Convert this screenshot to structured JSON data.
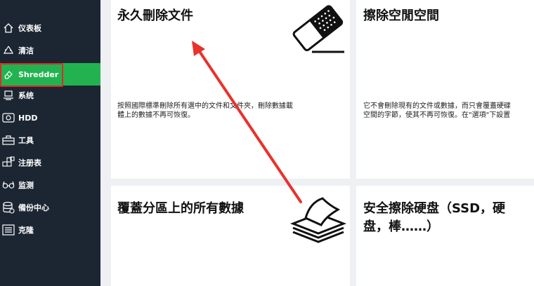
{
  "sidebar": {
    "items": [
      {
        "label": "仪表板",
        "icon": "home-icon"
      },
      {
        "label": "清洁",
        "icon": "recycle-icon"
      },
      {
        "label": "Shredder",
        "icon": "eraser-icon",
        "active": true
      },
      {
        "label": "系统",
        "icon": "system-icon"
      },
      {
        "label": "HDD",
        "icon": "hdd-icon"
      },
      {
        "label": "工具",
        "icon": "toolbox-icon"
      },
      {
        "label": "注册表",
        "icon": "registry-icon"
      },
      {
        "label": "监测",
        "icon": "glasses-icon"
      },
      {
        "label": "備份中心",
        "icon": "database-icon"
      },
      {
        "label": "克隆",
        "icon": "clone-icon"
      }
    ]
  },
  "cards": {
    "permanent_delete": {
      "title": "永久刪除文件",
      "desc_line1": "按照國際標準刪除所有選中的文件和文件夾，刪除數據載",
      "desc_line2": "體上的數據不再可恢復。",
      "icon": "eraser-icon"
    },
    "wipe_free_space": {
      "title": "擦除空閒空間",
      "desc_line1": "它不會刪除現有的文件或數據，而只會覆蓋硬碟",
      "desc_line2": "空間的字節，使其不再可恢復。在\"選項\"下設置"
    },
    "wipe_partition": {
      "title": "覆蓋分區上的所有數據",
      "icon": "paper-stack-icon"
    },
    "secure_erase": {
      "title_line1": "安全擦除硬盘（SSD，硬",
      "title_line2": "盘，棒……）"
    }
  },
  "colors": {
    "sidebar_bg": "#1c2633",
    "active_green": "#22b350",
    "highlight_red": "#e0282a",
    "arrow_red": "#e8322c"
  }
}
